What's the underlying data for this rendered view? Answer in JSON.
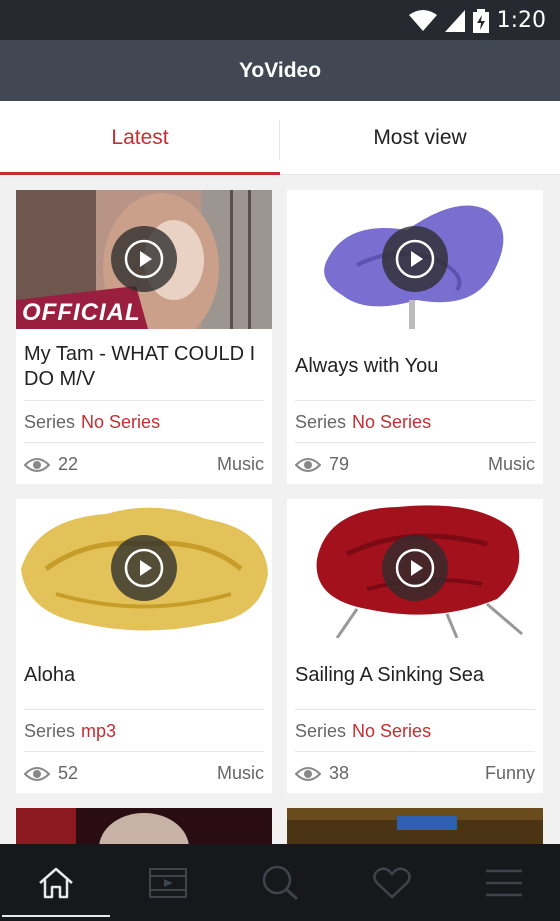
{
  "status": {
    "time": "1:20",
    "icons": [
      "wifi-icon",
      "signal-icon",
      "battery-charging-icon"
    ]
  },
  "app": {
    "title": "YoVideo"
  },
  "tabs": [
    {
      "label": "Latest",
      "active": true
    },
    {
      "label": "Most view",
      "active": false
    }
  ],
  "series_label": "Series",
  "videos": [
    {
      "title": "My Tam - WHAT COULD I DO M/V",
      "series": "No Series",
      "views": "22",
      "category": "Music",
      "thumb_badge": "OFFICIAL"
    },
    {
      "title": "Always with You",
      "series": "No Series",
      "views": "79",
      "category": "Music"
    },
    {
      "title": "Aloha",
      "series": "mp3",
      "views": "52",
      "category": "Music"
    },
    {
      "title": "Sailing A Sinking Sea",
      "series": "No Series",
      "views": "38",
      "category": "Funny"
    }
  ],
  "bottom_nav": [
    {
      "icon": "home-icon",
      "active": true
    },
    {
      "icon": "film-icon",
      "active": false
    },
    {
      "icon": "search-icon",
      "active": false
    },
    {
      "icon": "heart-icon",
      "active": false
    },
    {
      "icon": "menu-icon",
      "active": false
    }
  ],
  "colors": {
    "accent": "#c62d32",
    "appbar": "#414853",
    "statusbar": "#26292f",
    "nav": "#16181c"
  }
}
